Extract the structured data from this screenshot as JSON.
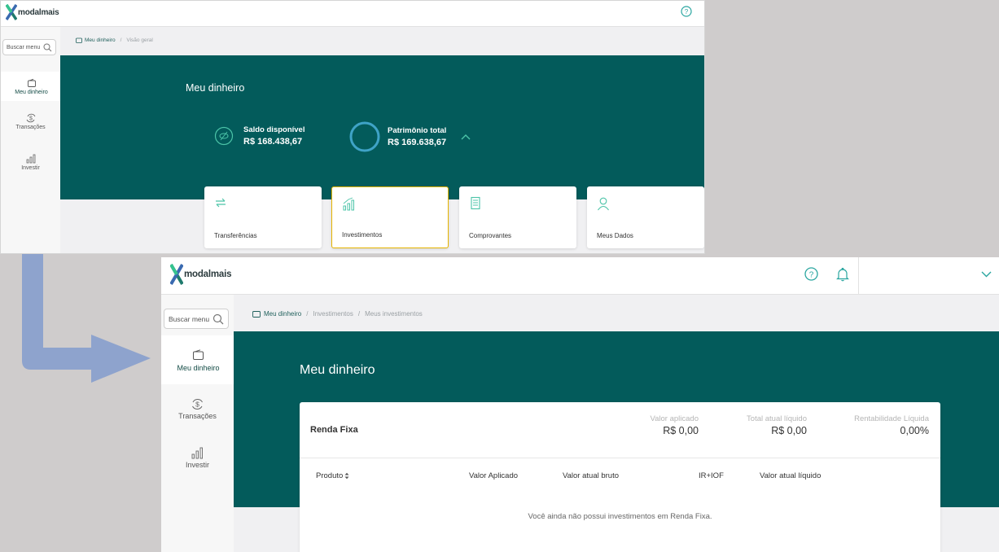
{
  "colors": {
    "teal": "#035b5b",
    "accent": "#4cc4a8",
    "highlight": "#e6b400",
    "arrow": "#8ea3cd"
  },
  "brand": {
    "name": "modalmais"
  },
  "icons": {
    "help": "help-circle-icon",
    "bell": "bell-icon",
    "chevron": "chevron-down-icon",
    "search": "search-icon",
    "wallet": "wallet-icon",
    "transactions": "dollar-exchange-icon",
    "invest": "bar-chart-icon"
  },
  "screen1": {
    "search_placeholder": "Buscar menu",
    "nav": [
      {
        "label": "Meu dinheiro",
        "active": true
      },
      {
        "label": "Transações",
        "active": false
      },
      {
        "label": "Investir",
        "active": false
      }
    ],
    "breadcrumb": [
      "Meu dinheiro",
      "Visão geral"
    ],
    "title": "Meu dinheiro",
    "saldo": {
      "label": "Saldo disponível",
      "value": "R$ 168.438,67"
    },
    "patrimonio": {
      "label": "Patrimônio total",
      "value": "R$ 169.638,67"
    },
    "cards": [
      {
        "label": "Transferências",
        "icon": "transfer-arrows-icon",
        "selected": false
      },
      {
        "label": "Investimentos",
        "icon": "bar-chart-icon",
        "selected": true
      },
      {
        "label": "Comprovantes",
        "icon": "receipt-icon",
        "selected": false
      },
      {
        "label": "Meus Dados",
        "icon": "user-icon",
        "selected": false
      }
    ]
  },
  "screen2": {
    "search_placeholder": "Buscar menu",
    "nav": [
      {
        "label": "Meu dinheiro",
        "active": true
      },
      {
        "label": "Transações",
        "active": false
      },
      {
        "label": "Investir",
        "active": false
      }
    ],
    "breadcrumb": [
      "Meu dinheiro",
      "Investimentos",
      "Meus investimentos"
    ],
    "title": "Meu dinheiro",
    "panel": {
      "title": "Renda Fixa",
      "stats": [
        {
          "label": "Valor aplicado",
          "value": "R$ 0,00"
        },
        {
          "label": "Total atual líquido",
          "value": "R$ 0,00"
        },
        {
          "label": "Rentabilidade Líquida",
          "value": "0,00%"
        }
      ],
      "columns": [
        "Produto",
        "Valor Aplicado",
        "Valor atual bruto",
        "IR+IOF",
        "Valor atual líquido"
      ],
      "empty_message": "Você ainda não possui investimentos em Renda Fixa."
    }
  }
}
